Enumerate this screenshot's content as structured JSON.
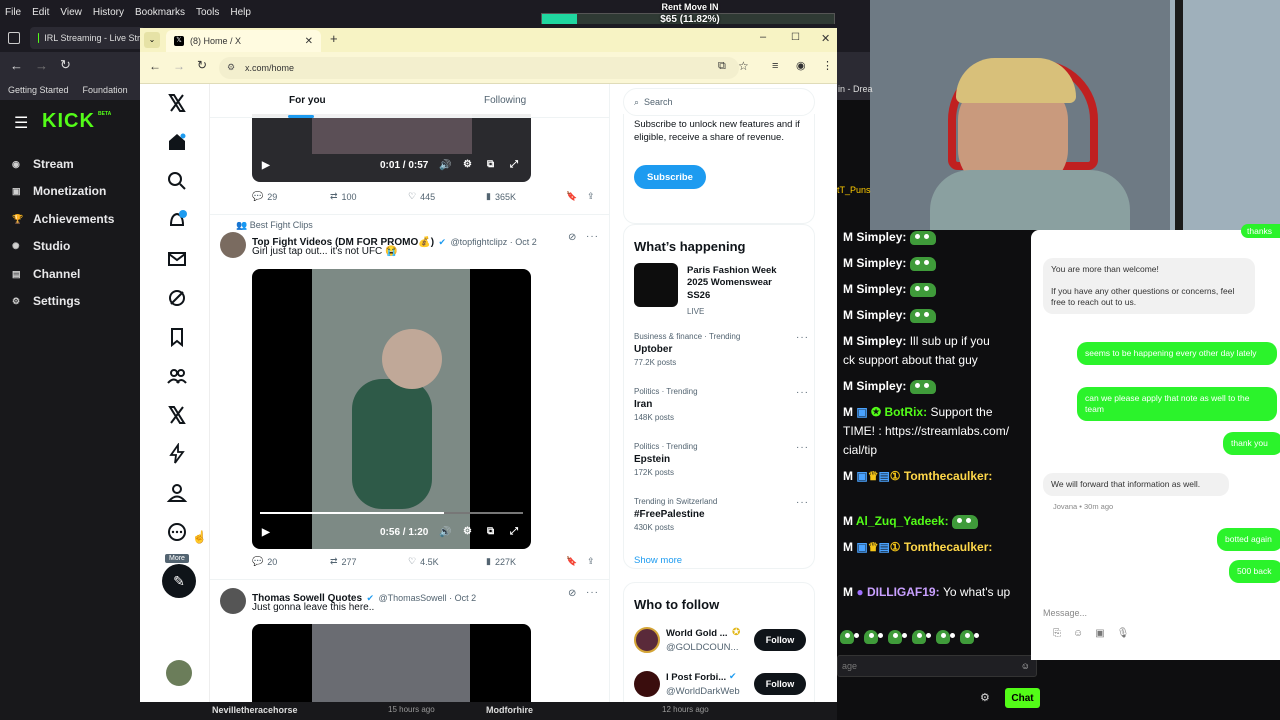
{
  "menubar": [
    "File",
    "Edit",
    "View",
    "History",
    "Bookmarks",
    "Tools",
    "Help"
  ],
  "overlay": {
    "title": "Rent Move IN",
    "amount": "$65 (11.82%)",
    "progress": 0.1182
  },
  "kick": {
    "tab_title": "IRL Streaming - Live Stre",
    "bookmarks": [
      "Getting Started",
      "Foundation"
    ],
    "logo": "KICK",
    "logo_badge": "BETA",
    "nav": [
      "Stream",
      "Monetization",
      "Achievements",
      "Studio",
      "Channel",
      "Settings"
    ]
  },
  "x": {
    "tab_title": "(8) Home / X",
    "url": "x.com/home",
    "tabs": [
      "For you",
      "Following"
    ],
    "search_placeholder": "Search",
    "more_tooltip": "More",
    "tweet0": {
      "video_time": "0:01 / 0:57",
      "replies": "29",
      "reposts": "100",
      "likes": "445",
      "views": "365K"
    },
    "tweet1": {
      "context": "Best Fight Clips",
      "name": "Top Fight Videos (DM FOR PROMO💰)",
      "handle": "@topfightclipz · Oct 2",
      "text": "Girl just tap out... it's not UFC 😭",
      "video_time": "0:56 / 1:20",
      "replies": "20",
      "reposts": "277",
      "likes": "4.5K",
      "views": "227K"
    },
    "tweet2": {
      "name": "Thomas Sowell Quotes",
      "handle": "@ThomasSowell · Oct 2",
      "text": "Just gonna leave this here.."
    },
    "premium": {
      "text": "Subscribe to unlock new features and if eligible, receive a share of revenue.",
      "button": "Subscribe"
    },
    "whats_happening": {
      "title": "What’s happening",
      "event": {
        "title": "Paris Fashion Week 2025 Womenswear SS26",
        "status": "LIVE"
      },
      "trends": [
        {
          "category": "Business & finance · Trending",
          "name": "Uptober",
          "posts": "77.2K posts"
        },
        {
          "category": "Politics · Trending",
          "name": "Iran",
          "posts": "148K posts"
        },
        {
          "category": "Politics · Trending",
          "name": "Epstein",
          "posts": "172K posts"
        },
        {
          "category": "Trending in Switzerland",
          "name": "#FreePalestine",
          "posts": "430K posts"
        }
      ],
      "show_more": "Show more"
    },
    "who_to_follow": {
      "title": "Who to follow",
      "accounts": [
        {
          "name": "World Gold ...",
          "handle": "@GOLDCOUN...",
          "button": "Follow"
        },
        {
          "name": "I Post Forbi...",
          "handle": "@WorldDarkWeb",
          "button": "Follow"
        }
      ]
    }
  },
  "kick_chat": {
    "lines": [
      {
        "user": "Simpley:",
        "text": ""
      },
      {
        "user": "Simpley:",
        "text": ""
      },
      {
        "user": "Simpley:",
        "text": ""
      },
      {
        "user": "Simpley:",
        "text": ""
      },
      {
        "user": "Simpley:",
        "text": "Ill sub up if you"
      },
      {
        "user": "",
        "text": "ck support about that guy"
      },
      {
        "user": "Simpley:",
        "text": ""
      },
      {
        "user": "BotRix:",
        "text": "Support the"
      },
      {
        "user": "",
        "text": "TIME! : https://streamlabs.com/"
      },
      {
        "user": "",
        "text": "cial/tip"
      },
      {
        "user": "Tomthecaulker:",
        "text": ""
      },
      {
        "user": "Al_Zuq_Yadeek:",
        "text": ""
      },
      {
        "user": "Tomthecaulker:",
        "text": ""
      },
      {
        "user": "DILLIGAF19:",
        "text": "Yo what's up"
      }
    ],
    "side_names": [
      "tT_Puns",
      "in - Drea"
    ],
    "input_placeholder": "age",
    "chat_button": "Chat"
  },
  "support_chat": {
    "in1": "You are more than welcome!\n\nIf you have any other questions or concerns, feel free to reach out to us.",
    "out1": "seems to be happening every other day lately",
    "out2": "can we please apply that note as well to the team",
    "out3": "thank you",
    "in2": "We will forward that information as well.",
    "agent": "Jovana • 30m ago",
    "out4": "botted again",
    "out5": "500 back",
    "top_clip": "thanks",
    "input_placeholder": "Message..."
  },
  "bottom": {
    "left": "Nevilletheracehorse",
    "left_time": "15 hours ago",
    "right": "Modforhire",
    "right_time": "12 hours ago"
  }
}
